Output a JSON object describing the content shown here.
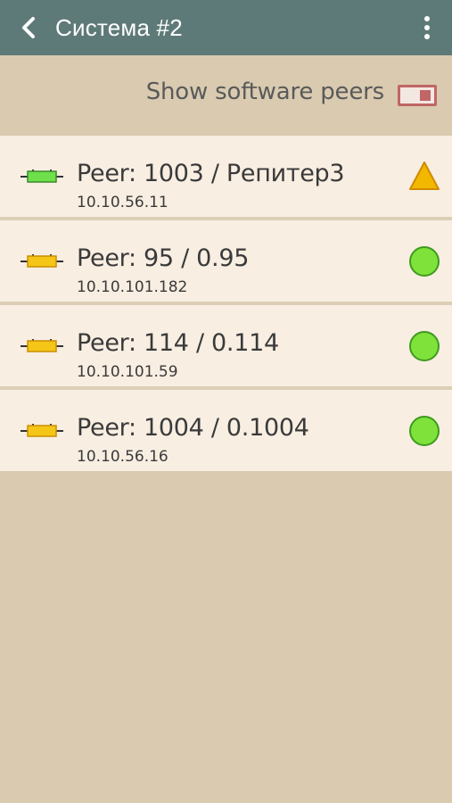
{
  "appbar": {
    "title": "Система #2",
    "back_icon": "chevron-left-icon",
    "menu_icon": "more-vert-icon"
  },
  "toggle_row": {
    "label": "Show software peers",
    "enabled": false
  },
  "peers": [
    {
      "name": "Peer: 1003 / Репитер3",
      "ip": "10.10.56.11",
      "device_icon": "device-icon",
      "device_color": "#6ee04a",
      "status": "warning",
      "status_icon": "warning-triangle-icon",
      "status_color": "#f2b800"
    },
    {
      "name": "Peer: 95 / 0.95",
      "ip": "10.10.101.182",
      "device_icon": "device-icon",
      "device_color": "#f5c518",
      "status": "ok",
      "status_icon": "ok-circle-icon",
      "status_color": "#7ee23a"
    },
    {
      "name": "Peer: 114 / 0.114",
      "ip": "10.10.101.59",
      "device_icon": "device-icon",
      "device_color": "#f5c518",
      "status": "ok",
      "status_icon": "ok-circle-icon",
      "status_color": "#7ee23a"
    },
    {
      "name": "Peer: 1004 / 0.1004",
      "ip": "10.10.56.16",
      "device_icon": "device-icon",
      "device_color": "#f5c518",
      "status": "ok",
      "status_icon": "ok-circle-icon",
      "status_color": "#7ee23a"
    }
  ],
  "colors": {
    "appbar_bg": "#5e7a78",
    "page_bg": "#d9cab0",
    "row_bg": "#f8eee2",
    "toggle_accent": "#c06666"
  }
}
